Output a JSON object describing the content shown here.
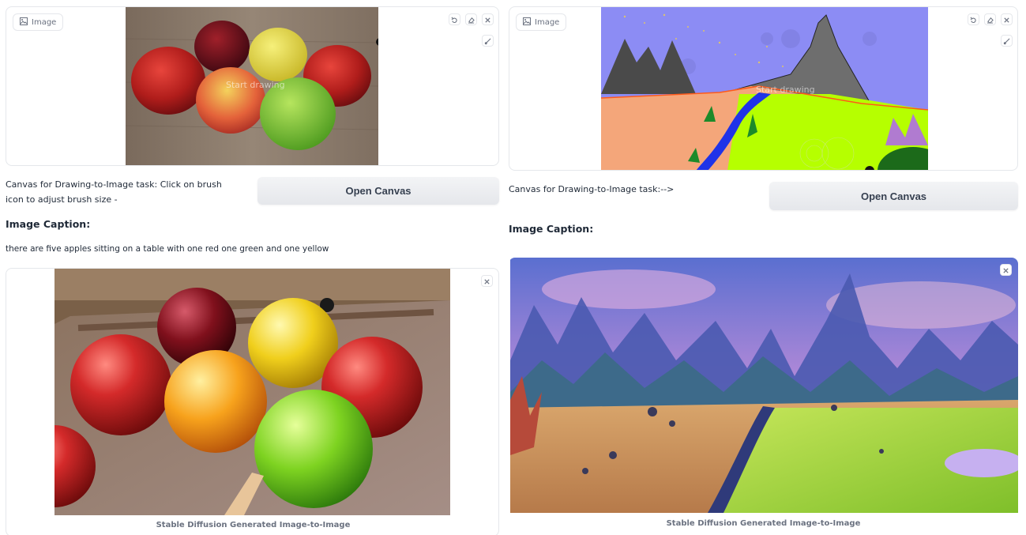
{
  "left": {
    "canvas": {
      "label": "Image",
      "overlay": "Start drawing"
    },
    "description": "Canvas for Drawing-to-Image task: Click on brush icon to adjust brush size -",
    "open_canvas_label": "Open Canvas",
    "caption_heading": "Image Caption:",
    "caption_text": "there are five apples sitting on a table with one red one green and one yellow",
    "output_label": "Stable Diffusion Generated Image-to-Image"
  },
  "right": {
    "canvas": {
      "label": "Image",
      "overlay": "Start drawing"
    },
    "description": "Canvas for Drawing-to-Image task:-->",
    "open_canvas_label": "Open Canvas",
    "caption_heading": "Image Caption:",
    "output_label": "Stable Diffusion Generated Image-to-Image"
  },
  "icons": {
    "image": "image-icon",
    "undo": "undo-icon",
    "erase": "eraser-icon",
    "close": "close-icon",
    "brush": "brush-icon"
  }
}
